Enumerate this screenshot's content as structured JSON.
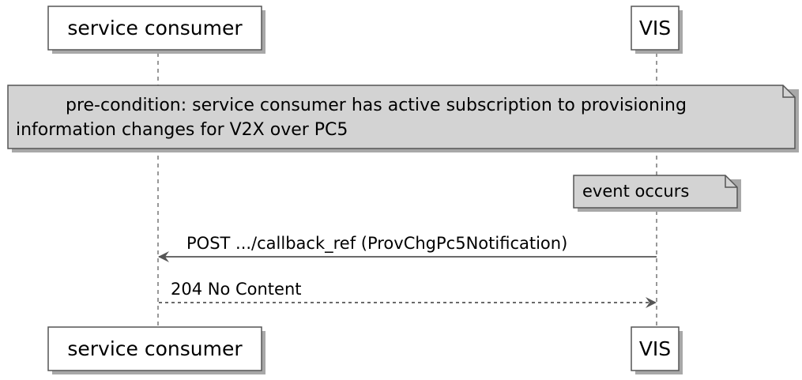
{
  "participants": [
    {
      "id": "consumer",
      "label": "service consumer"
    },
    {
      "id": "vis",
      "label": "VIS"
    }
  ],
  "notes": {
    "precondition": {
      "line1": "pre-condition: service consumer has active subscription to provisioning",
      "line2": "information changes for V2X over PC5"
    },
    "event": {
      "label": "event occurs"
    }
  },
  "messages": [
    {
      "from": "vis",
      "to": "consumer",
      "label": "POST .../callback_ref (ProvChgPc5Notification)",
      "style": "solid"
    },
    {
      "from": "consumer",
      "to": "vis",
      "label": "204 No Content",
      "style": "dashed"
    }
  ],
  "colors": {
    "note_fill": "#d3d3d3",
    "box_fill": "#ffffff",
    "stroke": "#555555",
    "arrow": "#555555",
    "shadow": "#a8a8a8"
  }
}
